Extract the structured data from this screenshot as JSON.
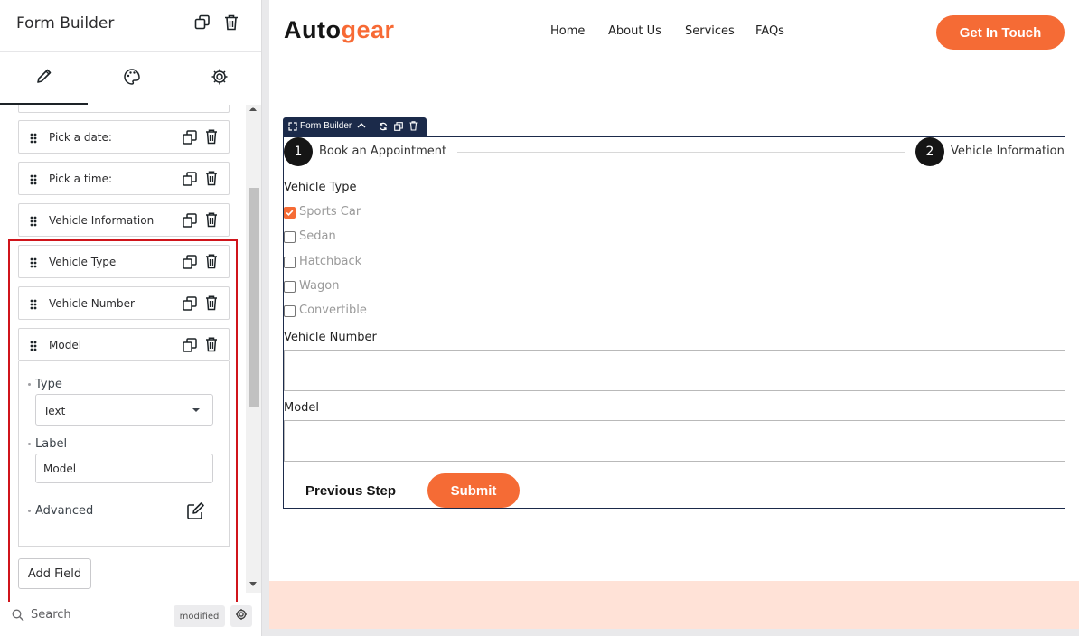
{
  "panel": {
    "title": "Form Builder",
    "tabs": [
      {
        "name": "content",
        "icon": "pencil-icon"
      },
      {
        "name": "style",
        "icon": "palette-icon"
      },
      {
        "name": "advanced",
        "icon": "gear-icon"
      }
    ],
    "fields": [
      {
        "label": "Pick a date:"
      },
      {
        "label": "Pick a time:"
      },
      {
        "label": "Vehicle Information"
      },
      {
        "label": "Vehicle Type"
      },
      {
        "label": "Vehicle Number"
      },
      {
        "label": "Model"
      }
    ],
    "model_settings": {
      "type_label": "Type",
      "type_value": "Text",
      "label_label": "Label",
      "label_value": "Model",
      "advanced_label": "Advanced"
    },
    "add_field_label": "Add Field",
    "footer": {
      "search_label": "Search",
      "modified_badge": "modified"
    }
  },
  "preview": {
    "logo": {
      "part1": "Auto",
      "part2": "gear"
    },
    "nav": [
      "Home",
      "About Us",
      "Services",
      "FAQs"
    ],
    "cta_label": "Get In Touch",
    "widget_tab_label": "Form Builder",
    "steps": [
      {
        "number": "1",
        "label": "Book an Appointment"
      },
      {
        "number": "2",
        "label": "Vehicle Information"
      }
    ],
    "vehicle_type_label": "Vehicle Type",
    "vehicle_types": [
      {
        "label": "Sports Car",
        "checked": true
      },
      {
        "label": "Sedan",
        "checked": false
      },
      {
        "label": "Hatchback",
        "checked": false
      },
      {
        "label": "Wagon",
        "checked": false
      },
      {
        "label": "Convertible",
        "checked": false
      }
    ],
    "vehicle_number_label": "Vehicle Number",
    "model_label": "Model",
    "prev_step_label": "Previous Step",
    "submit_label": "Submit",
    "accent_color": "#f56b35"
  }
}
